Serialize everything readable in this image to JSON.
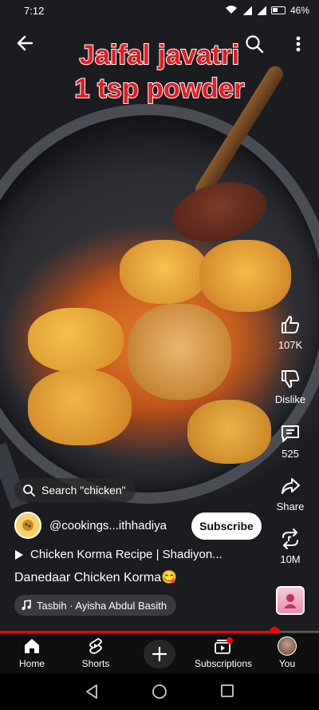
{
  "status_bar": {
    "time": "7:12",
    "battery": "46%"
  },
  "video": {
    "overlay_caption": "Jaifal javatri\n1 tsp powder"
  },
  "actions": {
    "like_count": "107K",
    "dislike_label": "Dislike",
    "comment_count": "525",
    "share_label": "Share",
    "remix_count": "10M"
  },
  "search_chip": {
    "label": "Search \"chicken\""
  },
  "channel": {
    "handle": "@cookings...ithhadiya",
    "subscribe_label": "Subscribe"
  },
  "video_title": "Chicken Korma Recipe | Shadiyon...",
  "description": "Danedaar Chicken Korma😋",
  "music": {
    "label": "Tasbih · Ayisha Abdul Basith"
  },
  "progress": {
    "fraction": 0.86
  },
  "bottom_nav": {
    "home": "Home",
    "shorts": "Shorts",
    "subscriptions": "Subscriptions",
    "you": "You"
  },
  "colors": {
    "accent": "#ff0000",
    "caption_text": "#e51c23"
  }
}
